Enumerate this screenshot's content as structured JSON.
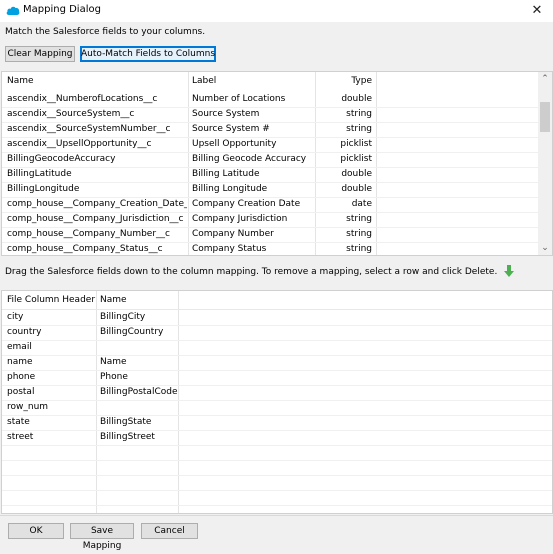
{
  "window": {
    "title": "Mapping Dialog",
    "close": "✕"
  },
  "instructions_top": "Match the Salesforce fields to your columns.",
  "buttons": {
    "clear": "Clear Mapping",
    "auto_match": "Auto-Match Fields to Columns",
    "ok": "OK",
    "save": "Save Mapping",
    "cancel": "Cancel"
  },
  "fields_table": {
    "headers": {
      "name": "Name",
      "label": "Label",
      "type": "Type"
    },
    "rows": [
      {
        "name": "ascendix__NumberofLocations__c",
        "label": "Number of Locations",
        "type": "double"
      },
      {
        "name": "ascendix__SourceSystem__c",
        "label": "Source System",
        "type": "string"
      },
      {
        "name": "ascendix__SourceSystemNumber__c",
        "label": "Source System #",
        "type": "string"
      },
      {
        "name": "ascendix__UpsellOpportunity__c",
        "label": "Upsell Opportunity",
        "type": "picklist"
      },
      {
        "name": "BillingGeocodeAccuracy",
        "label": "Billing Geocode Accuracy",
        "type": "picklist"
      },
      {
        "name": "BillingLatitude",
        "label": "Billing Latitude",
        "type": "double"
      },
      {
        "name": "BillingLongitude",
        "label": "Billing Longitude",
        "type": "double"
      },
      {
        "name": "comp_house__Company_Creation_Date__c",
        "label": "Company Creation Date",
        "type": "date"
      },
      {
        "name": "comp_house__Company_Jurisdiction__c",
        "label": "Company Jurisdiction",
        "type": "string"
      },
      {
        "name": "comp_house__Company_Number__c",
        "label": "Company Number",
        "type": "string"
      },
      {
        "name": "comp_house__Company_Status__c",
        "label": "Company Status",
        "type": "string"
      }
    ]
  },
  "instructions_bottom": "Drag the Salesforce fields down to the column mapping.  To remove a mapping, select a row and click Delete.",
  "mapping_table": {
    "headers": {
      "column": "File Column Header",
      "name": "Name"
    },
    "rows": [
      {
        "column": "city",
        "name": "BillingCity"
      },
      {
        "column": "country",
        "name": "BillingCountry"
      },
      {
        "column": "email",
        "name": ""
      },
      {
        "column": "name",
        "name": "Name"
      },
      {
        "column": "phone",
        "name": "Phone"
      },
      {
        "column": "postal",
        "name": "BillingPostalCode"
      },
      {
        "column": "row_num",
        "name": ""
      },
      {
        "column": "state",
        "name": "BillingState"
      },
      {
        "column": "street",
        "name": "BillingStreet"
      },
      {
        "column": "",
        "name": ""
      },
      {
        "column": "",
        "name": ""
      },
      {
        "column": "",
        "name": ""
      },
      {
        "column": "",
        "name": ""
      }
    ]
  },
  "colors": {
    "accent": "#0078d7",
    "arrow": "#4caf50",
    "salesforce": "#00a1e0"
  }
}
